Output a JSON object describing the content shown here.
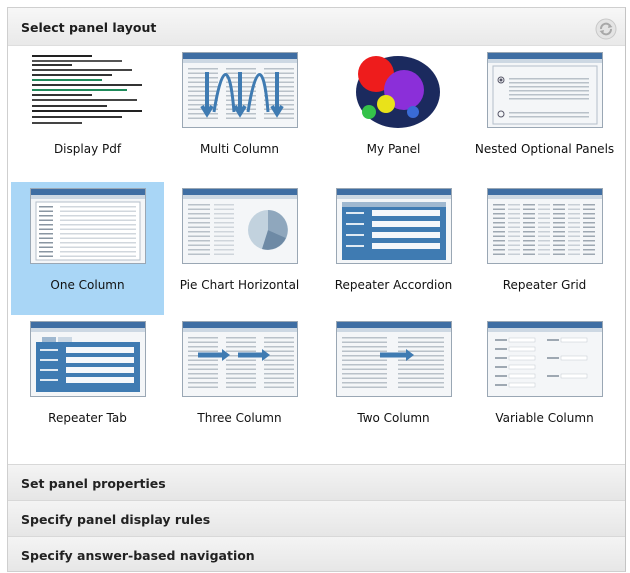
{
  "header": {
    "title": "Select panel layout"
  },
  "icons": {
    "refresh": "refresh-icon"
  },
  "layouts": [
    {
      "label": "Display Pdf",
      "thumb": "pdf"
    },
    {
      "label": "Multi Column",
      "thumb": "multi"
    },
    {
      "label": "My Panel",
      "thumb": "circles"
    },
    {
      "label": "Nested Optional Panels",
      "thumb": "nested"
    },
    {
      "label": "One Column",
      "thumb": "one",
      "selected": true
    },
    {
      "label": "Pie Chart Horizontal",
      "thumb": "pie"
    },
    {
      "label": "Repeater Accordion",
      "thumb": "accordion"
    },
    {
      "label": "Repeater Grid",
      "thumb": "grid"
    },
    {
      "label": "Repeater Tab",
      "thumb": "tab"
    },
    {
      "label": "Three Column",
      "thumb": "three"
    },
    {
      "label": "Two Column",
      "thumb": "two"
    },
    {
      "label": "Variable Column",
      "thumb": "variable"
    }
  ],
  "sections": [
    {
      "label": "Set panel properties"
    },
    {
      "label": "Specify panel display rules"
    },
    {
      "label": "Specify answer-based navigation"
    }
  ],
  "colors": {
    "selected": "#a9d6f6",
    "header_bg": "#efefef",
    "thumb_blue": "#3f7bb2"
  }
}
